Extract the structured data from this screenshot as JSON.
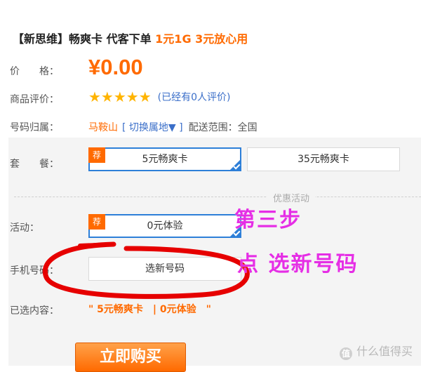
{
  "title": {
    "bracket": "【新思维】",
    "main": "畅爽卡 代客下单 ",
    "highlight": "1元1G 3元放心用"
  },
  "price": {
    "label": "价　　格：",
    "value": "¥0.00"
  },
  "rating": {
    "label": "商品评价：",
    "stars": "★★★★★",
    "text": "(已经有0人评价)"
  },
  "origin": {
    "label": "号码归属：",
    "city": "马鞍山",
    "switch": "[ 切换属地▼ ]",
    "range": "配送范围：全国"
  },
  "package": {
    "label": "套　　餐：",
    "options": [
      {
        "label": "5元畅爽卡",
        "badge": "荐",
        "selected": true
      },
      {
        "label": "35元畅爽卡",
        "selected": false
      }
    ]
  },
  "promo": {
    "divider": "优惠活动",
    "label": "活动：",
    "option": {
      "label": "0元体验",
      "badge": "荐",
      "selected": true
    }
  },
  "phone": {
    "label": "手机号码：",
    "button": "选新号码"
  },
  "chosen": {
    "label": "已选内容：",
    "value": "\" 5元畅爽卡　| 0元体验　\""
  },
  "buy_button": "立即购买",
  "annotations": {
    "step": "第三步",
    "instruction": "点 选新号码"
  },
  "annotation_color": "#e52ee5",
  "accent_color": "#ff6a00",
  "watermark": {
    "icon": "值",
    "text": "什么值得买"
  }
}
